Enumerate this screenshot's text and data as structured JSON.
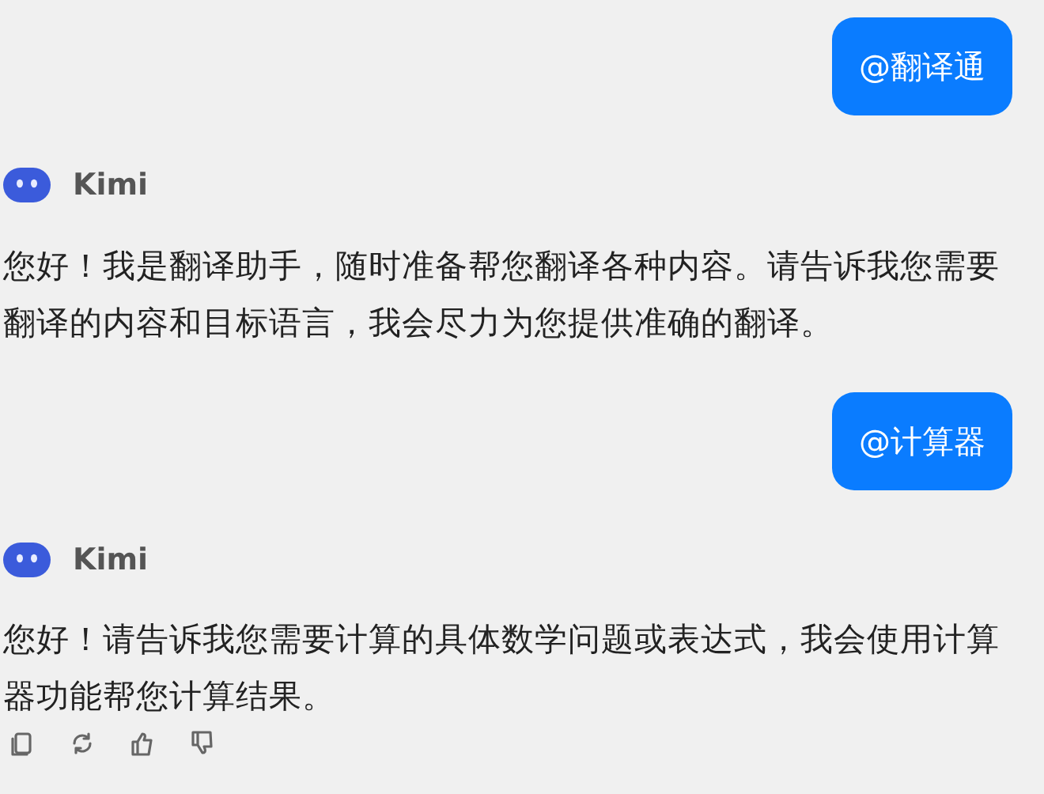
{
  "messages": [
    {
      "kind": "user",
      "text": "@翻译通"
    },
    {
      "kind": "assistant",
      "sender": "Kimi",
      "text": "您好！我是翻译助手，随时准备帮您翻译各种内容。请告诉我您需要翻译的内容和目标语言，我会尽力为您提供准确的翻译。",
      "actions": false
    },
    {
      "kind": "user",
      "text": "@计算器"
    },
    {
      "kind": "assistant",
      "sender": "Kimi",
      "text": "您好！请告诉我您需要计算的具体数学问题或表达式，我会使用计算器功能帮您计算结果。",
      "actions": true
    }
  ]
}
